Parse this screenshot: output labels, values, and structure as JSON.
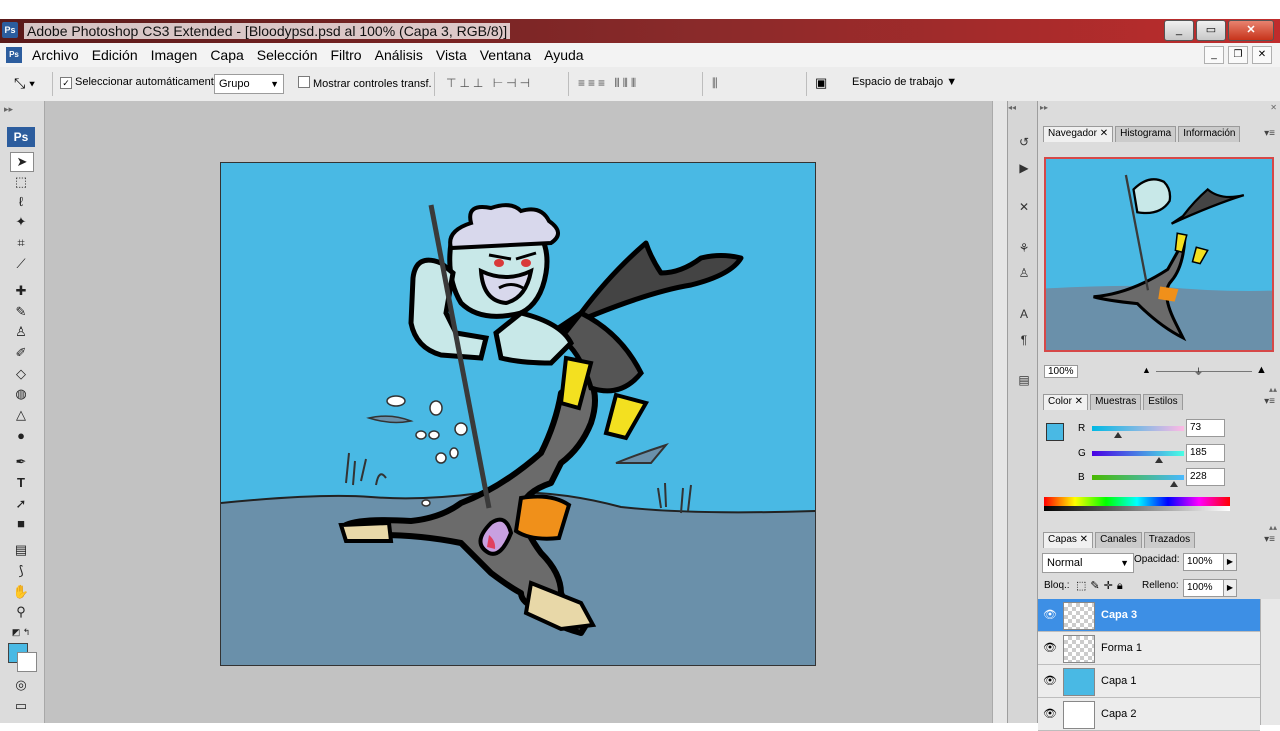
{
  "window": {
    "title": "Adobe Photoshop CS3 Extended - [Bloodypsd.psd al 100% (Capa 3, RGB/8)]",
    "app_icon": "Ps",
    "minimize": "_",
    "maximize": "▭",
    "close": "✕"
  },
  "menu": {
    "items": [
      "Archivo",
      "Edición",
      "Imagen",
      "Capa",
      "Selección",
      "Filtro",
      "Análisis",
      "Vista",
      "Ventana",
      "Ayuda"
    ]
  },
  "options": {
    "auto_select_label": "Seleccionar automáticamente:",
    "auto_select_checked": true,
    "auto_select_value": "Grupo",
    "show_transform_label": "Mostrar controles transf.",
    "workspace_label": "Espacio de trabajo"
  },
  "toolbox": {
    "logo": "Ps",
    "foreground_color": "#49b9e4",
    "background_color": "#ffffff"
  },
  "navigator": {
    "tabs": [
      "Navegador",
      "Histograma",
      "Información"
    ],
    "zoom": "100%"
  },
  "color_panel": {
    "tabs": [
      "Color",
      "Muestras",
      "Estilos"
    ],
    "channels": [
      {
        "label": "R",
        "value": "73"
      },
      {
        "label": "G",
        "value": "185"
      },
      {
        "label": "B",
        "value": "228"
      }
    ],
    "swatch": "#49b9e4"
  },
  "layers_panel": {
    "tabs": [
      "Capas",
      "Canales",
      "Trazados"
    ],
    "blend_mode": "Normal",
    "opacity_label": "Opacidad:",
    "opacity_value": "100%",
    "lock_label": "Bloq.:",
    "fill_label": "Relleno:",
    "fill_value": "100%",
    "layers": [
      {
        "name": "Capa 3",
        "selected": true
      },
      {
        "name": "Forma 1",
        "selected": false
      },
      {
        "name": "Capa 1",
        "selected": false
      },
      {
        "name": "Capa 2",
        "selected": false
      }
    ]
  },
  "colors": {
    "sky": "#49b9e4",
    "sea": "#6a90aa",
    "selection": "#3d8fe5"
  }
}
